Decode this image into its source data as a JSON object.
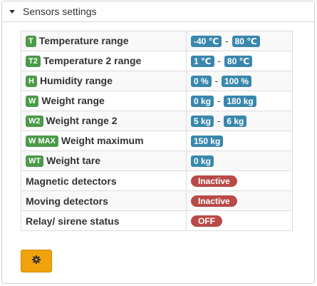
{
  "panel": {
    "title": "Sensors settings"
  },
  "rows": [
    {
      "tag": "T",
      "label": "Temperature range",
      "v1": "-40 ℃",
      "v2": "80 ℃"
    },
    {
      "tag": "T2",
      "label": "Temperature 2 range",
      "v1": "1 ℃",
      "v2": "80 ℃"
    },
    {
      "tag": "H",
      "label": "Humidity range",
      "v1": "0 %",
      "v2": "100 %"
    },
    {
      "tag": "W",
      "label": "Weight range",
      "v1": "0 kg",
      "v2": "180 kg"
    },
    {
      "tag": "W2",
      "label": "Weight range 2",
      "v1": "5 kg",
      "v2": "6 kg"
    },
    {
      "tag": "W MAX",
      "label": "Weight maximum",
      "v1": "150 kg"
    },
    {
      "tag": "WT",
      "label": "Weight tare",
      "v1": "0 kg"
    },
    {
      "label": "Magnetic detectors",
      "status": "Inactive"
    },
    {
      "label": "Moving detectors",
      "status": "Inactive"
    },
    {
      "label": "Relay/ sirene status",
      "status": "OFF"
    }
  ],
  "separator": "-",
  "settings_button": {
    "icon": "gear-icon"
  },
  "colors": {
    "tag_green": "#4b9a48",
    "value_blue": "#3a87ad",
    "status_red": "#b94a48",
    "button_orange": "#f0a30a"
  }
}
